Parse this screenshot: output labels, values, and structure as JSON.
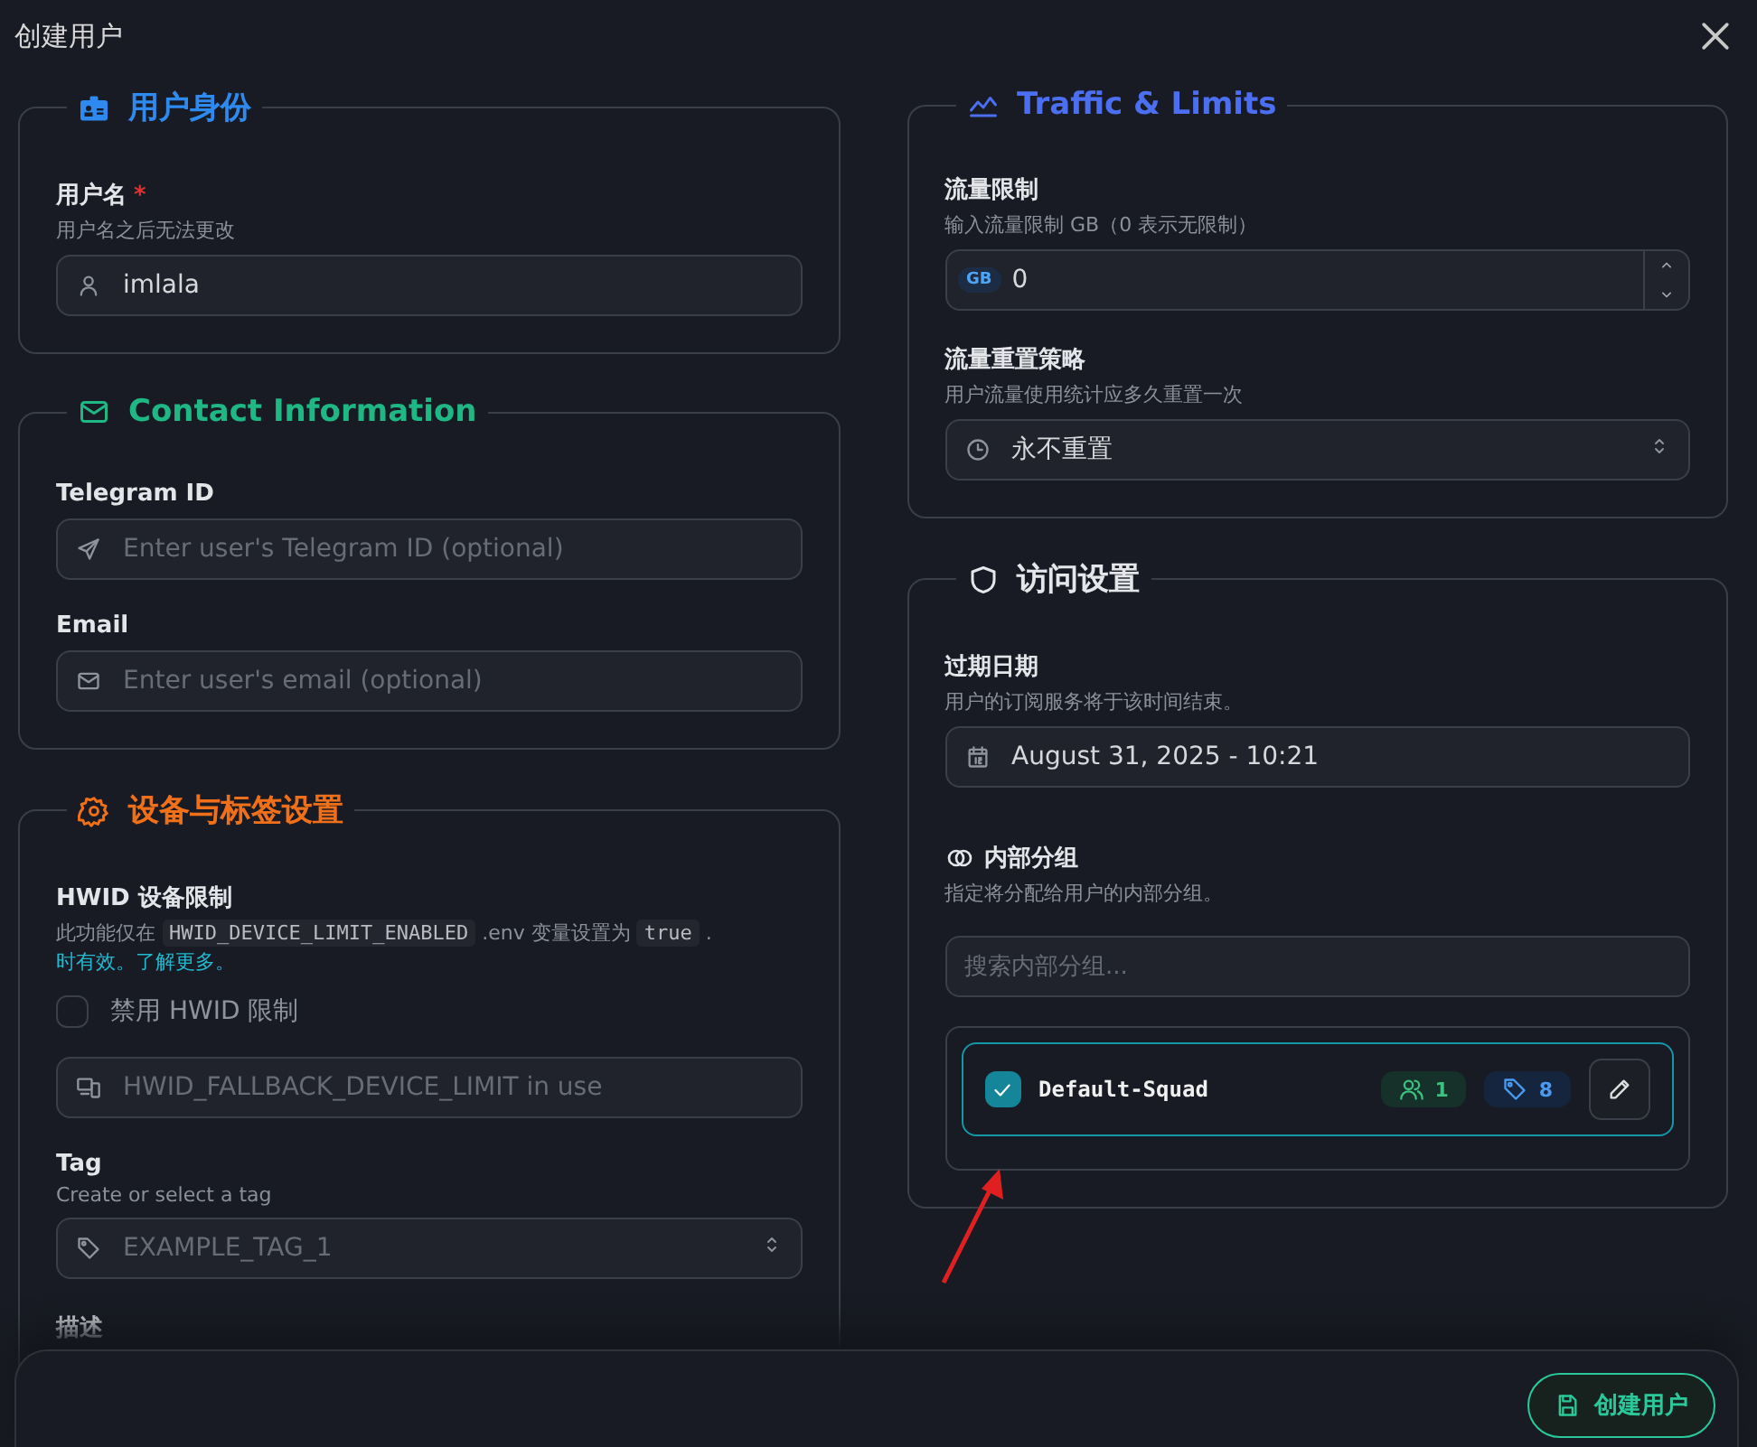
{
  "dialog": {
    "title": "创建用户"
  },
  "left_sections": [
    {
      "kind": "identity",
      "title": "用户身份",
      "color": "#2f8af0",
      "fields": [
        {
          "kind": "username",
          "label": "用户名",
          "required": true,
          "required_mark": "*",
          "hint": "用户名之后无法更改",
          "value": "imlala"
        }
      ]
    },
    {
      "kind": "contact",
      "title": "Contact Information",
      "color": "#1fb784",
      "fields": [
        {
          "kind": "telegram",
          "label": "Telegram ID",
          "placeholder": "Enter user's Telegram ID (optional)"
        },
        {
          "kind": "email",
          "label": "Email",
          "placeholder": "Enter user's email (optional)"
        }
      ]
    },
    {
      "kind": "device",
      "title": "设备与标签设置",
      "color": "#f0701a",
      "fields": [
        {
          "kind": "note",
          "label": "HWID 设备限制",
          "parts": [
            {
              "kind": "text",
              "text": "此功能仅在"
            },
            {
              "kind": "code",
              "text": "HWID_DEVICE_LIMIT_ENABLED"
            },
            {
              "kind": "text",
              "text": ".env 变量设置为"
            },
            {
              "kind": "code",
              "text": "true"
            },
            {
              "kind": "text",
              "text": "."
            },
            {
              "kind": "link",
              "text": "时有效。了解更多。"
            }
          ]
        },
        {
          "kind": "toggle",
          "label": "禁用 HWID 限制",
          "checked": false
        },
        {
          "kind": "devices",
          "placeholder": "HWID_FALLBACK_DEVICE_LIMIT in use"
        },
        {
          "kind": "tag",
          "label": "Tag",
          "hint": "Create or select a tag",
          "placeholder": "EXAMPLE_TAG_1"
        },
        {
          "kind": "description",
          "label": "描述"
        }
      ]
    }
  ],
  "right_sections": [
    {
      "kind": "traffic",
      "title": "Traffic & Limits",
      "color": "#4c6ef0",
      "fields": [
        {
          "kind": "limit",
          "label": "流量限制",
          "hint": "输入流量限制 GB（0 表示无限制）",
          "unit": "GB",
          "value": "0"
        },
        {
          "kind": "reset",
          "label": "流量重置策略",
          "hint": "用户流量使用统计应多久重置一次",
          "value": "永不重置"
        }
      ]
    },
    {
      "kind": "access",
      "title": "访问设置",
      "color": "#e4e6ea",
      "fields": [
        {
          "kind": "date",
          "label": "过期日期",
          "hint": "用户的订阅服务将于该时间结束。",
          "value": "August 31, 2025 - 10:21"
        },
        {
          "kind": "groups",
          "label": "内部分组",
          "hint": "指定将分配给用户的内部分组。",
          "placeholder": "搜索内部分组...",
          "items": [
            {
              "name": "Default-Squad",
              "checked": true,
              "members": "1",
              "tags": "8"
            }
          ]
        }
      ]
    }
  ],
  "footer": {
    "submit": "创建用户"
  }
}
